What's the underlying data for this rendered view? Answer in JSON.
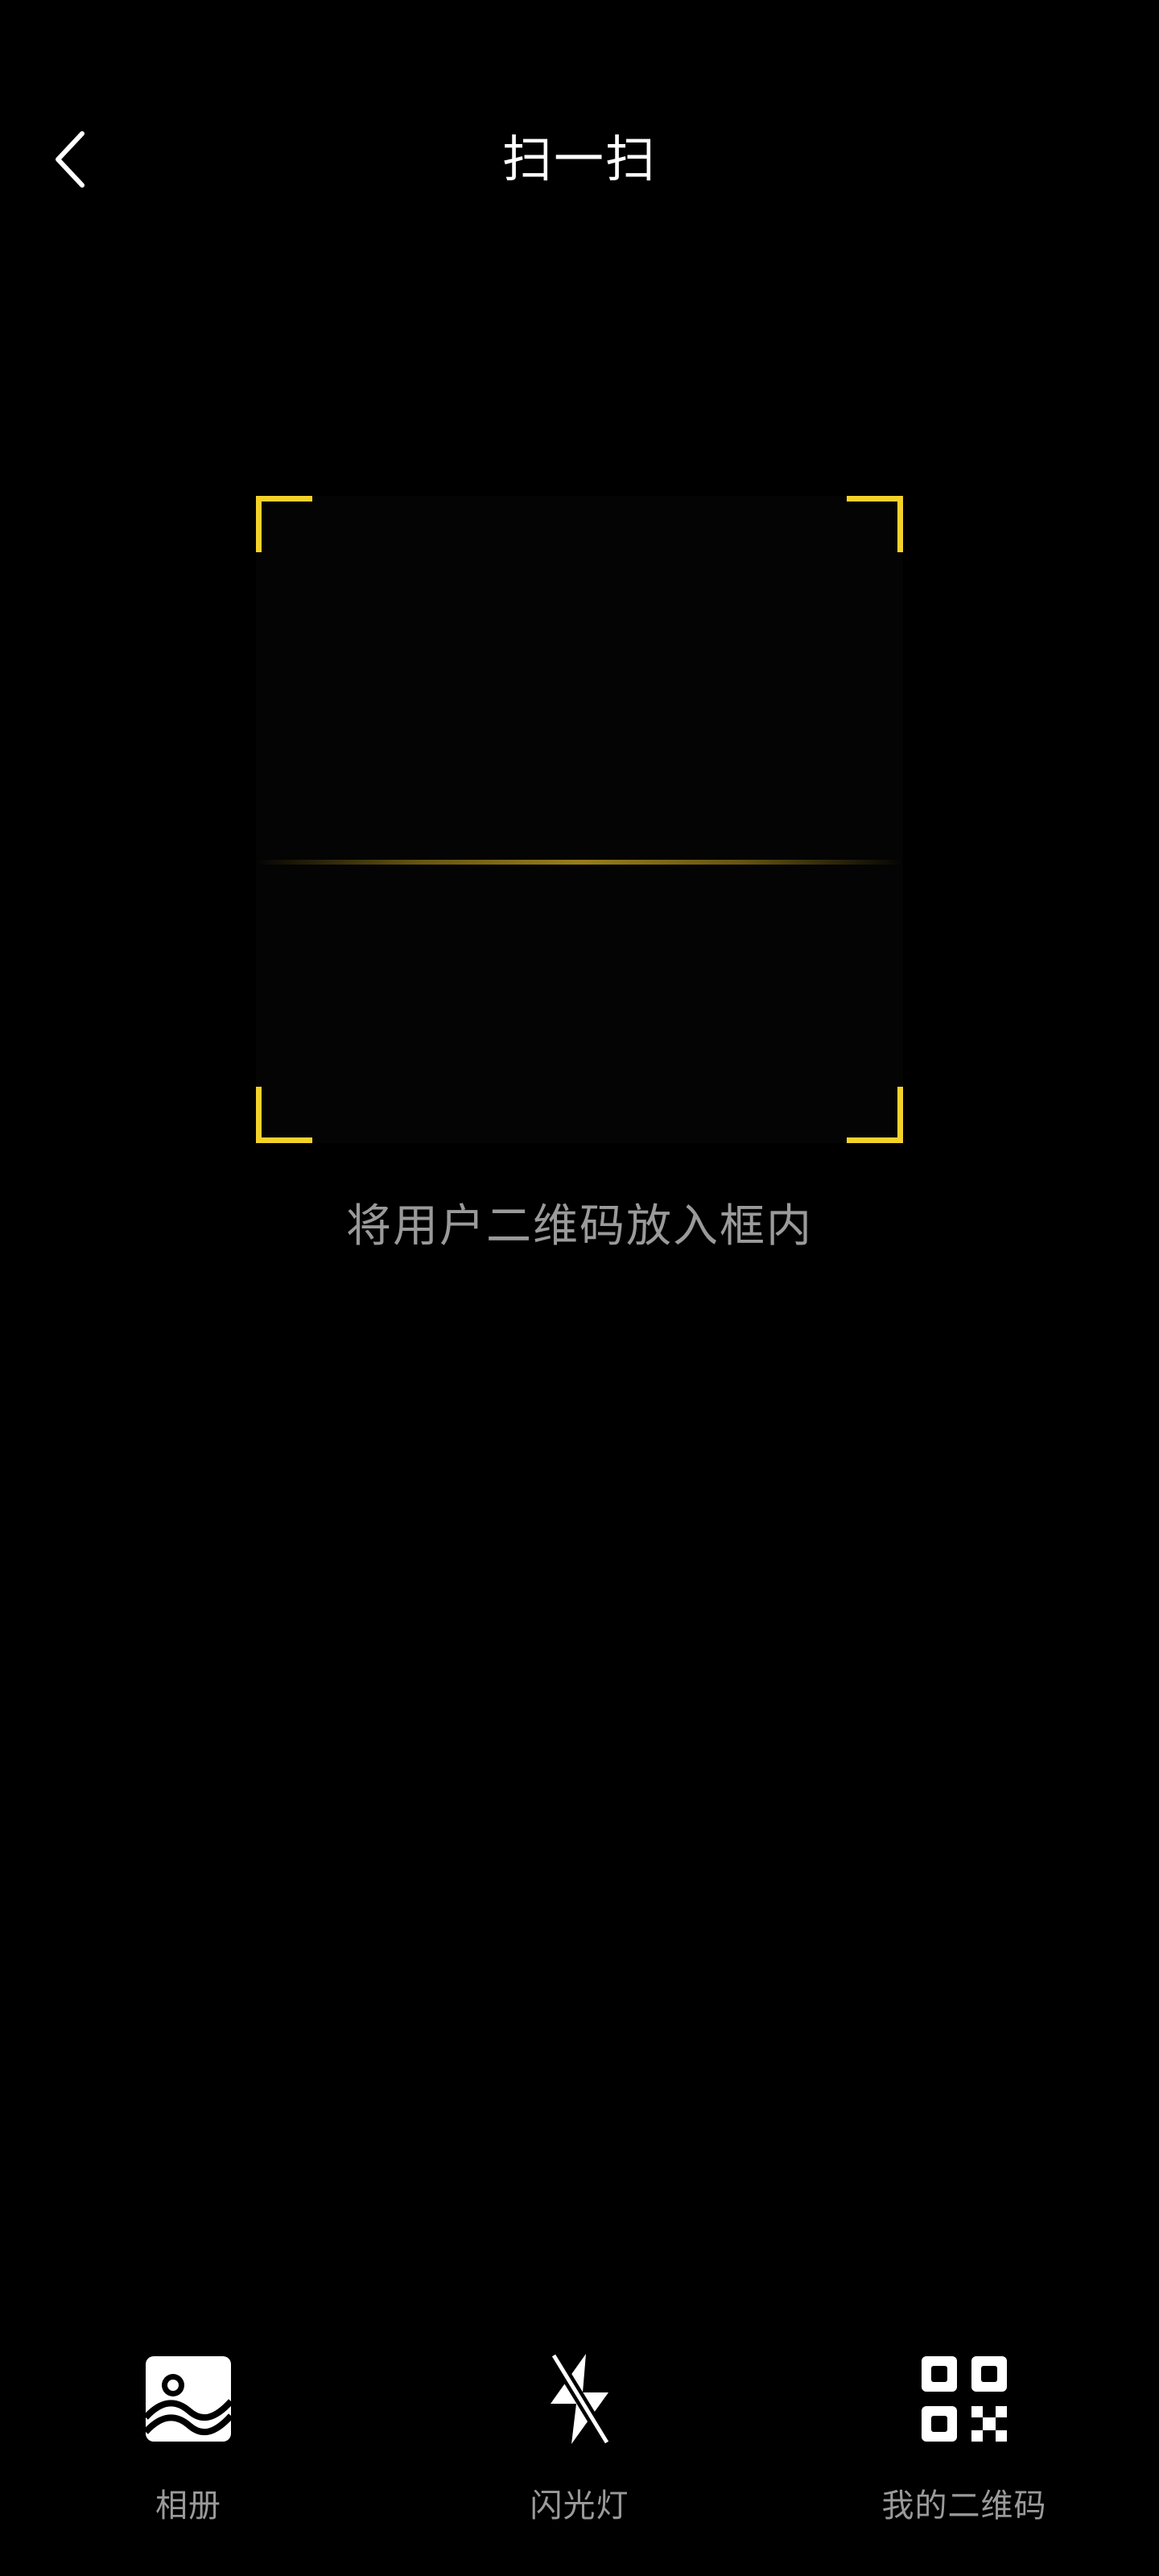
{
  "header": {
    "title": "扫一扫",
    "back_icon": "chevron-left-icon"
  },
  "scanner": {
    "hint": "将用户二维码放入框内",
    "frame_color": "#f5d22a",
    "scan_line_color": "#c8a523"
  },
  "toolbar": {
    "items": [
      {
        "label": "相册",
        "icon": "image-icon"
      },
      {
        "label": "闪光灯",
        "icon": "flash-off-icon"
      },
      {
        "label": "我的二维码",
        "icon": "qr-code-icon"
      }
    ]
  },
  "colors": {
    "background": "#000000",
    "title": "#ffffff",
    "secondary_text": "#9a9a9a"
  }
}
